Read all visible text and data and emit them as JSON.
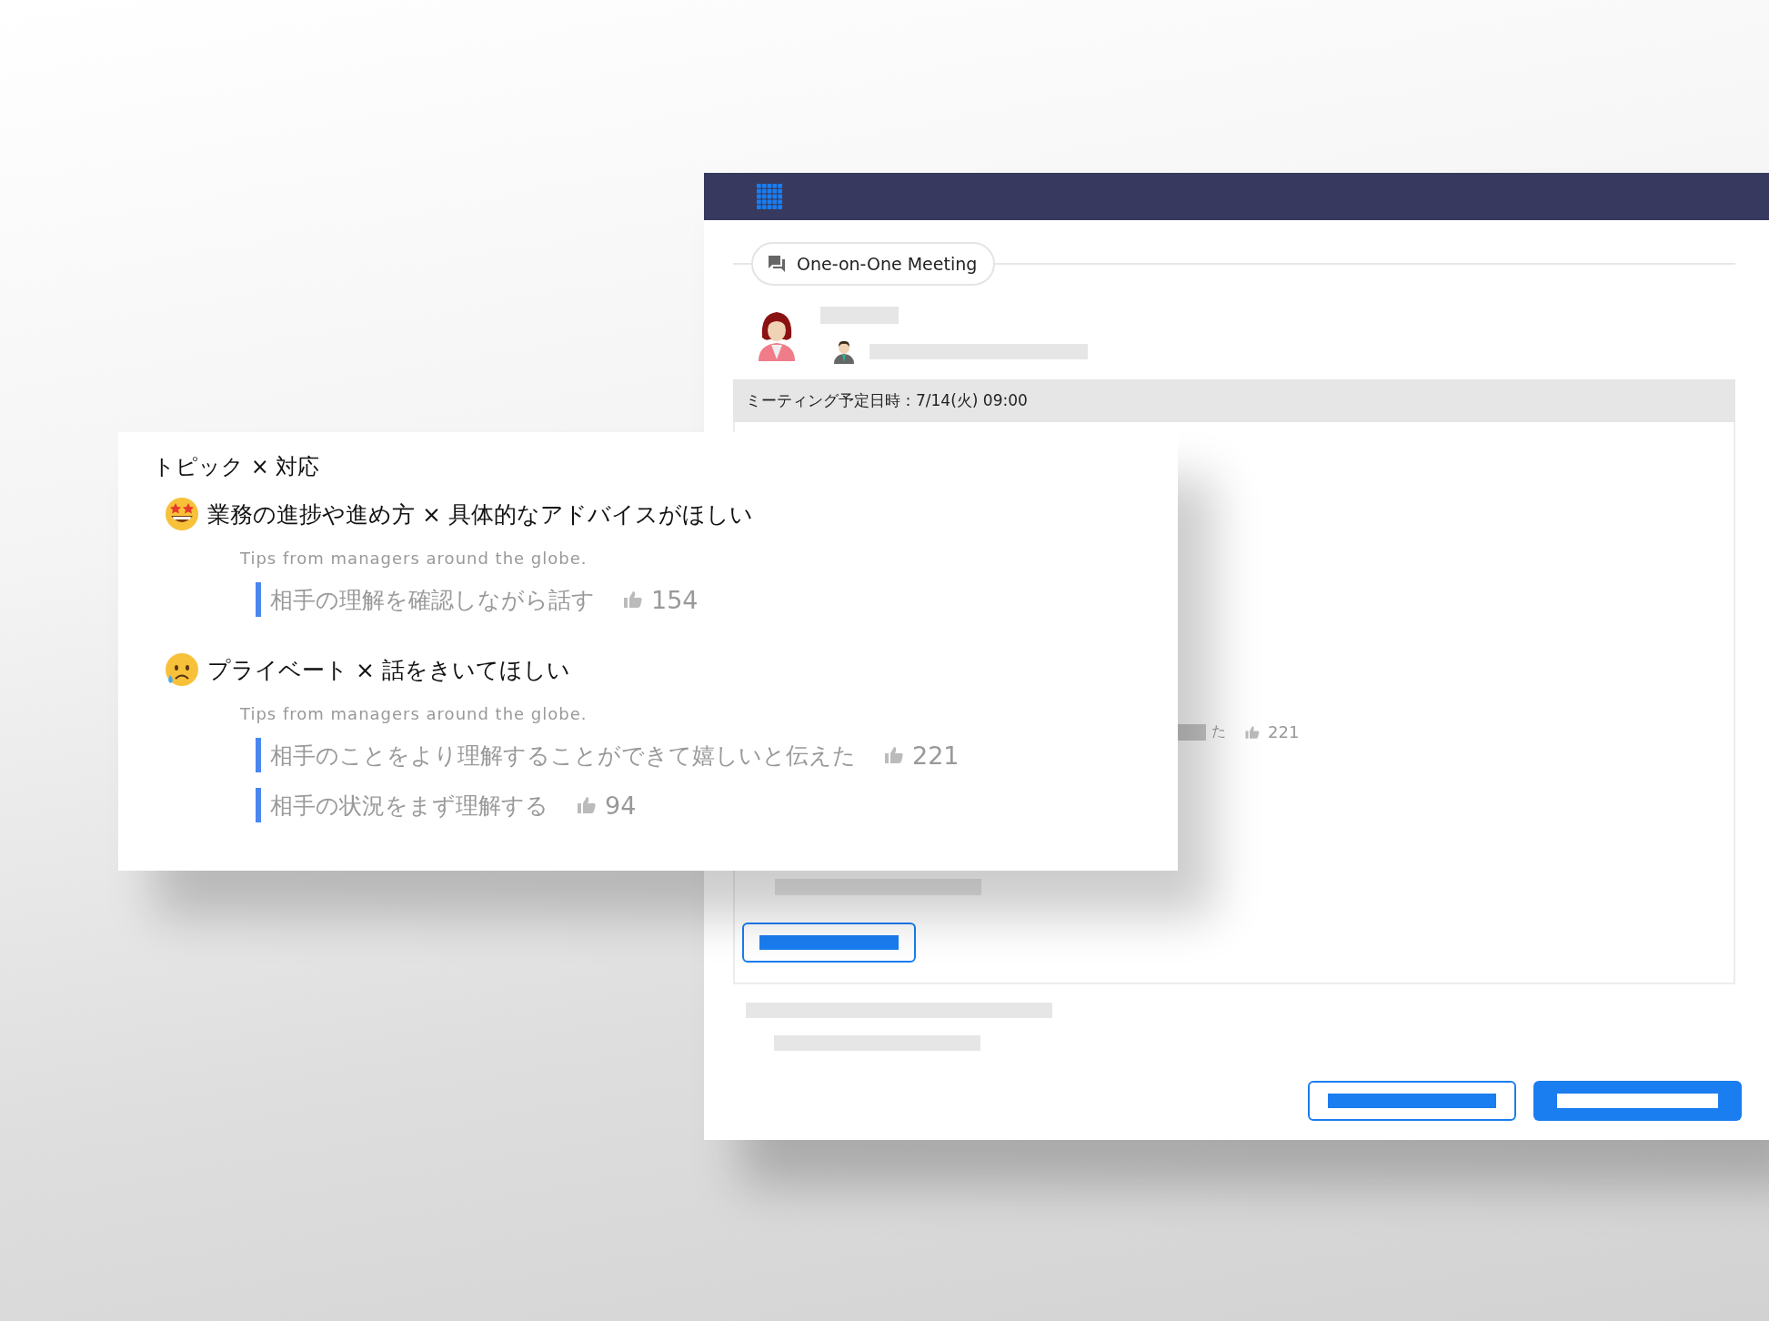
{
  "meeting_window": {
    "meeting_type": "One-on-One Meeting",
    "schedule": "ミーティング予定日時：7/14(火) 09:00",
    "covered_row": {
      "text_end": "た",
      "likes": "221"
    }
  },
  "topic_card": {
    "title": "トピック × 対応",
    "topics": [
      {
        "kind": "star-struck",
        "title": "業務の進捗や進め方 × 具体的なアドバイスがほしい",
        "subtitle": "Tips from managers around the globe.",
        "tips": [
          {
            "text": "相手の理解を確認しながら話す",
            "likes": "154"
          }
        ]
      },
      {
        "kind": "sad",
        "title": "プライベート × 話をきいてほしい",
        "subtitle": "Tips from managers around the globe.",
        "tips": [
          {
            "text": "相手のことをより理解することができて嬉しいと伝えた",
            "likes": "221"
          },
          {
            "text": "相手の状況をまず理解する",
            "likes": "94"
          }
        ]
      }
    ]
  }
}
